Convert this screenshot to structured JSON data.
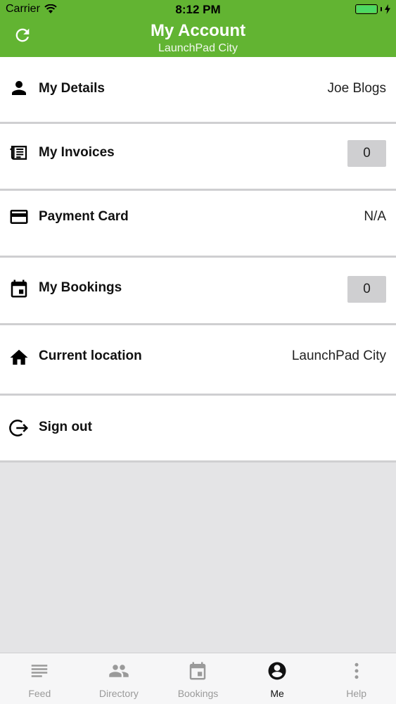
{
  "status_bar": {
    "carrier": "Carrier",
    "time": "8:12 PM"
  },
  "header": {
    "title": "My Account",
    "subtitle": "LaunchPad City"
  },
  "rows": {
    "details": {
      "label": "My Details",
      "value": "Joe Blogs",
      "icon": "person-icon"
    },
    "invoices": {
      "label": "My Invoices",
      "value": "0",
      "icon": "newspaper-icon"
    },
    "payment": {
      "label": "Payment Card",
      "value": "N/A",
      "icon": "credit-card-icon"
    },
    "bookings": {
      "label": "My Bookings",
      "value": "0",
      "icon": "calendar-icon"
    },
    "location": {
      "label": "Current location",
      "value": "LaunchPad City",
      "icon": "home-icon"
    },
    "signout": {
      "label": "Sign out",
      "icon": "sign-out-icon"
    }
  },
  "tabs": [
    {
      "label": "Feed",
      "icon": "feed-icon",
      "active": false
    },
    {
      "label": "Directory",
      "icon": "people-icon",
      "active": false
    },
    {
      "label": "Bookings",
      "icon": "calendar-icon",
      "active": false
    },
    {
      "label": "Me",
      "icon": "account-circle-icon",
      "active": true
    },
    {
      "label": "Help",
      "icon": "more-vertical-icon",
      "active": false
    }
  ],
  "colors": {
    "brand": "#62b432",
    "badge": "#cfcfd1",
    "background": "#e4e4e6"
  }
}
